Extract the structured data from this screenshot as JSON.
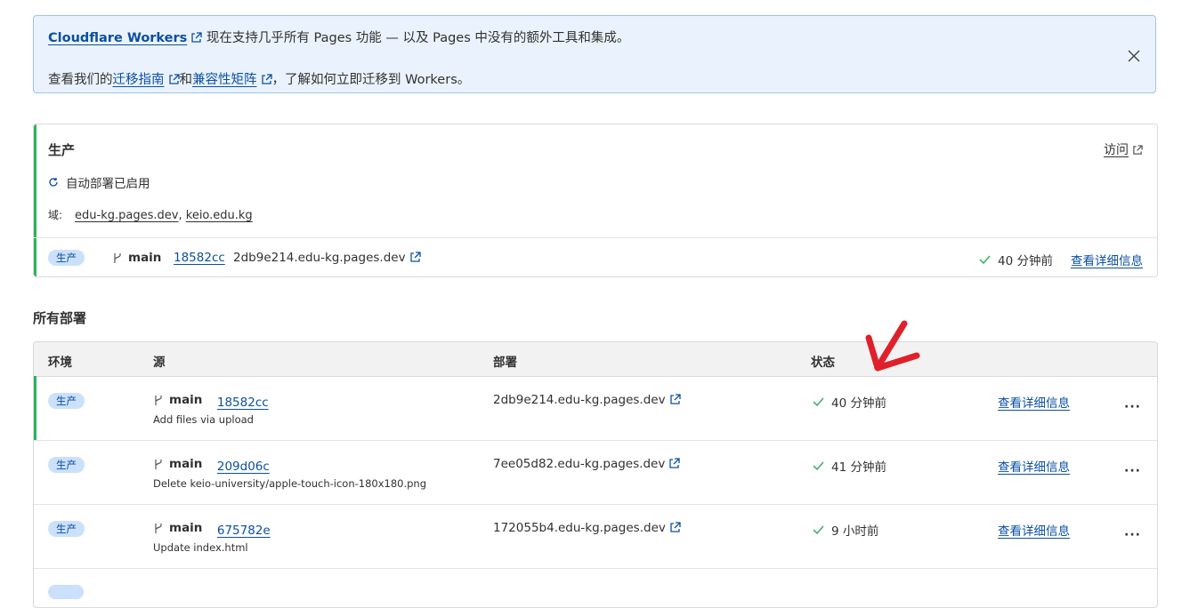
{
  "banner": {
    "workers_link": "Cloudflare Workers",
    "line1_text": "现在支持几乎所有 Pages 功能 — 以及 Pages 中没有的额外工具和集成。",
    "line2_prefix": "查看我们的",
    "migration_link": "迁移指南",
    "and_text": "和",
    "compat_link": "兼容性矩阵",
    "line2_suffix": "，了解如何立即迁移到 Workers。"
  },
  "production": {
    "title": "生产",
    "visit_label": "访问",
    "autodeploy_text": "自动部署已启用",
    "domains_label": "域:",
    "domain1": "edu-kg.pages.dev",
    "domain_sep": ",",
    "domain2": "keio.edu.kg",
    "row": {
      "badge": "生产",
      "branch": "main",
      "commit": "18582cc",
      "deployment": "2db9e214.edu-kg.pages.dev",
      "status": "40 分钟前",
      "details": "查看详细信息"
    }
  },
  "all_deployments": {
    "title": "所有部署",
    "columns": [
      "环境",
      "源",
      "部署",
      "状态"
    ],
    "rows": [
      {
        "env": "生产",
        "branch": "main",
        "commit": "18582cc",
        "message": "Add files via upload",
        "deployment": "2db9e214.edu-kg.pages.dev",
        "status": "40 分钟前",
        "details": "查看详细信息",
        "more": "···"
      },
      {
        "env": "生产",
        "branch": "main",
        "commit": "209d06c",
        "message": "Delete keio-university/apple-touch-icon-180x180.png",
        "deployment": "7ee05d82.edu-kg.pages.dev",
        "status": "41 分钟前",
        "details": "查看详细信息",
        "more": "···"
      },
      {
        "env": "生产",
        "branch": "main",
        "commit": "675782e",
        "message": "Update index.html",
        "deployment": "172055b4.edu-kg.pages.dev",
        "status": "9 小时前",
        "details": "查看详细信息",
        "more": "···"
      }
    ]
  },
  "colors": {
    "accent_green": "#2db35d",
    "link_blue": "#0b4fa1",
    "banner_bg": "#eaf3fd",
    "annotation_red": "#e0202a"
  }
}
